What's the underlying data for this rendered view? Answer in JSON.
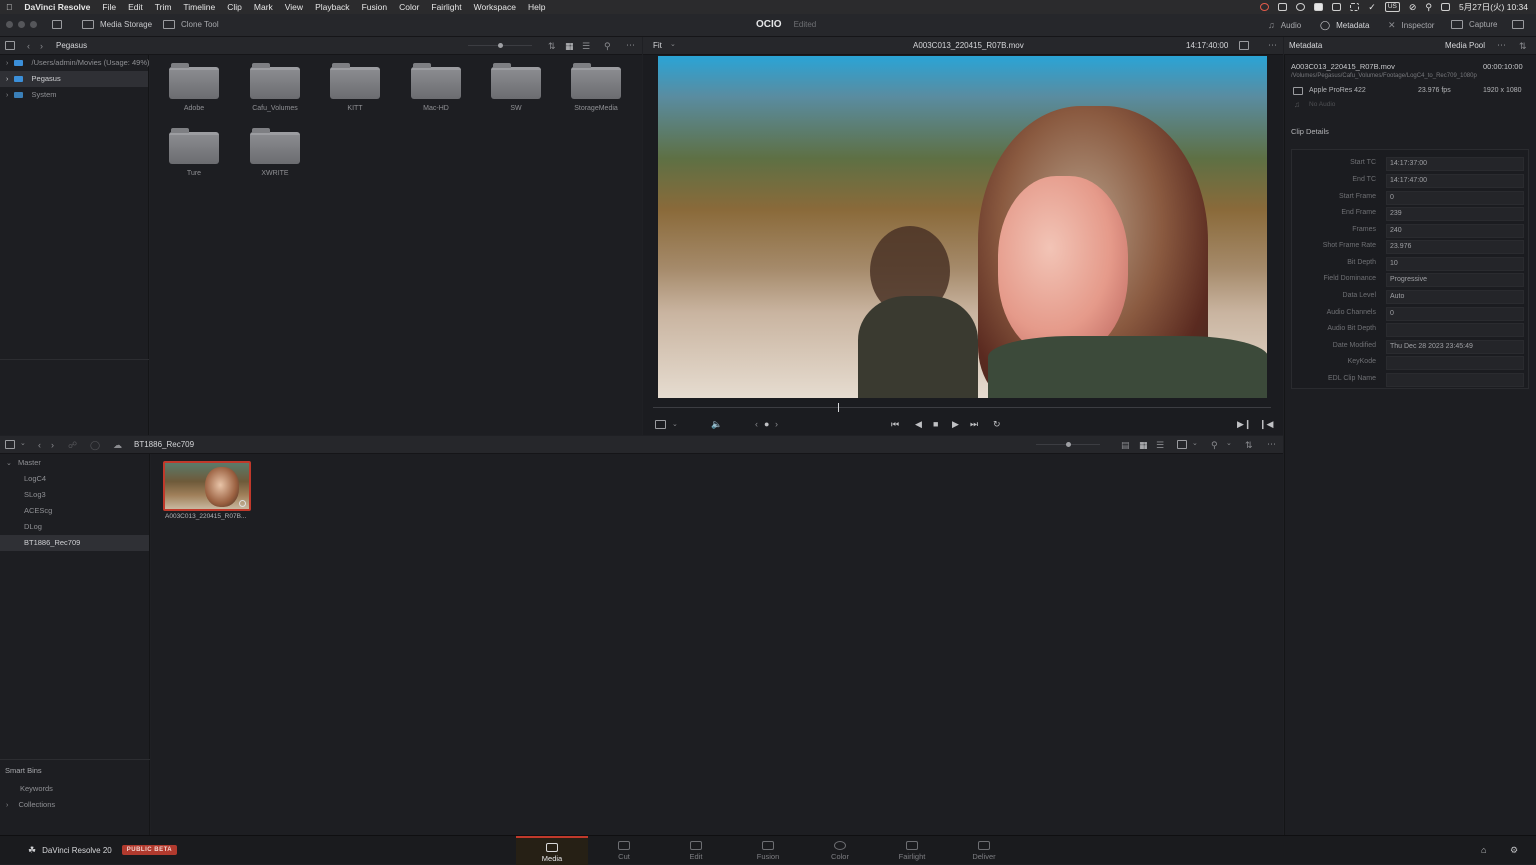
{
  "menubar": {
    "app_name": "DaVinci Resolve",
    "items": [
      "File",
      "Edit",
      "Trim",
      "Timeline",
      "Clip",
      "Mark",
      "View",
      "Playback",
      "Fusion",
      "Color",
      "Fairlight",
      "Workspace",
      "Help"
    ],
    "clock": "5月27日(火) 10:34",
    "input_badge": "US"
  },
  "toolbar": {
    "media_storage": "Media Storage",
    "clone_tool": "Clone Tool",
    "project_name": "OCIO",
    "project_state": "Edited",
    "audio": "Audio",
    "metadata": "Metadata",
    "inspector": "Inspector",
    "capture": "Capture"
  },
  "storage": {
    "location": "Pegasus",
    "tree": [
      {
        "label": "/Users/admin/Movies (Usage: 49%)"
      },
      {
        "label": "Pegasus"
      },
      {
        "label": "System"
      }
    ],
    "folders": [
      "Adobe",
      "Cafu_Volumes",
      "KITT",
      "Mac-HD",
      "SW",
      "StorageMedia",
      "Ture",
      "XWRITE"
    ]
  },
  "viewer": {
    "zoom": "Fit",
    "clip_name": "A003C013_220415_R07B.mov",
    "timecode": "14:17:40:00",
    "playhead_fraction": 0.3
  },
  "metadata": {
    "title": "Metadata",
    "media_pool": "Media Pool",
    "file_name": "A003C013_220415_R07B.mov",
    "duration": "00:00:10:00",
    "path": "/Volumes/Pegasus/Cafu_Volumes/Footage/LogC4_to_Rec709_1080p",
    "codec": "Apple ProRes 422",
    "fps": "23.976 fps",
    "resolution": "1920 x 1080",
    "audio": "No Audio",
    "section": "Clip Details",
    "rows": [
      {
        "k": "Start TC",
        "v": "14:17:37:00"
      },
      {
        "k": "End TC",
        "v": "14:17:47:00"
      },
      {
        "k": "Start Frame",
        "v": "0"
      },
      {
        "k": "End Frame",
        "v": "239"
      },
      {
        "k": "Frames",
        "v": "240"
      },
      {
        "k": "Shot Frame Rate",
        "v": "23.976"
      },
      {
        "k": "Bit Depth",
        "v": "10"
      },
      {
        "k": "Field Dominance",
        "v": "Progressive"
      },
      {
        "k": "Data Level",
        "v": "Auto"
      },
      {
        "k": "Audio Channels",
        "v": "0"
      },
      {
        "k": "Audio Bit Depth",
        "v": ""
      },
      {
        "k": "Date Modified",
        "v": "Thu Dec 28 2023 23:45:49"
      },
      {
        "k": "KeyKode",
        "v": ""
      },
      {
        "k": "EDL Clip Name",
        "v": ""
      }
    ]
  },
  "pool": {
    "current_bin": "BT1886_Rec709",
    "bins": [
      {
        "label": "Master"
      },
      {
        "label": "LogC4"
      },
      {
        "label": "SLog3"
      },
      {
        "label": "ACEScg"
      },
      {
        "label": "DLog"
      },
      {
        "label": "BT1886_Rec709"
      }
    ],
    "smart_bins": "Smart Bins",
    "smart_items": [
      {
        "label": "Keywords"
      },
      {
        "label": "Collections"
      }
    ],
    "clip_label": "A003C013_220415_R07B..."
  },
  "pages": {
    "brand": "DaVinci Resolve 20",
    "badge": "PUBLIC BETA",
    "items": [
      "Media",
      "Cut",
      "Edit",
      "Fusion",
      "Color",
      "Fairlight",
      "Deliver"
    ]
  },
  "colors": {
    "accent": "#c0392b",
    "selection": "#3b8fd9"
  }
}
